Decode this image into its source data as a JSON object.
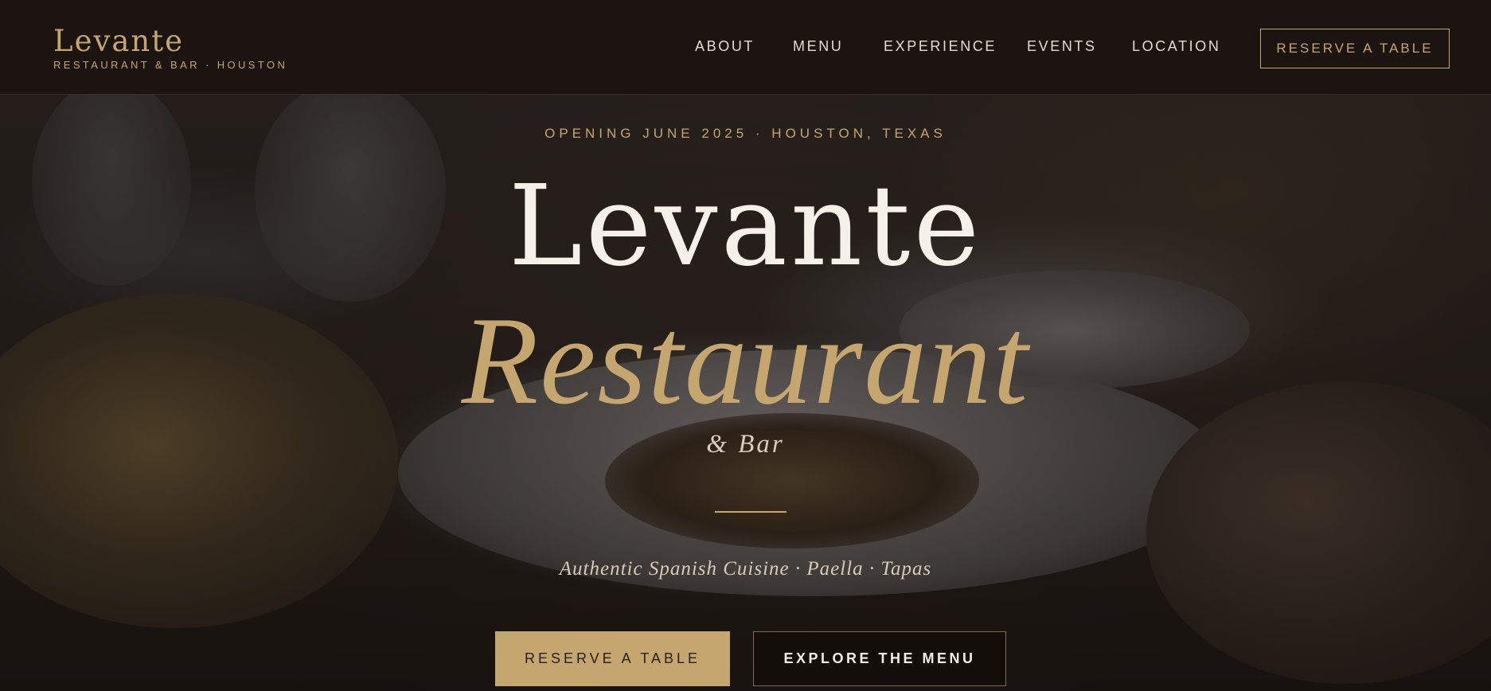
{
  "nav": {
    "brand_name": "Levante",
    "brand_sub": "RESTAURANT & BAR · HOUSTON",
    "links": [
      "ABOUT",
      "MENU",
      "EXPERIENCE",
      "EVENTS",
      "LOCATION"
    ],
    "cta_label": "RESERVE A TABLE"
  },
  "hero": {
    "eyebrow": "OPENING JUNE 2025 · HOUSTON, TEXAS",
    "title_main": "Levante",
    "title_sub": "Restaurant",
    "title_amp": "& Bar",
    "tagline": "Authentic Spanish Cuisine · Paella · Tapas",
    "primary_button": "RESERVE A TABLE",
    "secondary_button": "EXPLORE THE MENU"
  },
  "colors": {
    "accent_gold": "#c6a66f",
    "nav_background": "#1b1410",
    "title_white": "#f6f1e8"
  }
}
